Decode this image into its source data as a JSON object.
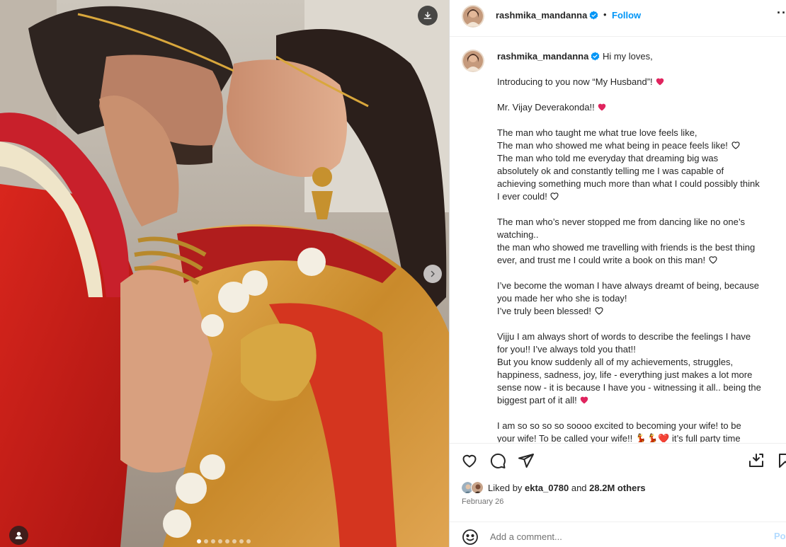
{
  "media": {
    "download_icon": "download-icon",
    "next_icon": "chevron-right-icon",
    "tag_icon": "person-tag-icon",
    "carousel_count": 8,
    "carousel_active": 0
  },
  "header": {
    "username": "rashmika_mandanna",
    "separator": "•",
    "follow": "Follow",
    "more": "···"
  },
  "caption": {
    "username": "rashmika_mandanna",
    "first_line": "Hi my loves,",
    "lines": [
      {
        "text": "",
        "heart": ""
      },
      {
        "text": "Introducing to you now “My Husband”!",
        "heart": "red"
      },
      {
        "text": "",
        "heart": ""
      },
      {
        "text": "Mr. Vijay Deverakonda!!",
        "heart": "red"
      },
      {
        "text": "",
        "heart": ""
      },
      {
        "text": "The man who taught me what true love feels like,",
        "heart": ""
      },
      {
        "text": "The man who showed me what being in peace feels like!",
        "heart": "outline"
      },
      {
        "text": "The man who told me everyday that dreaming big was",
        "heart": ""
      },
      {
        "text": "absolutely ok and constantly telling me I was capable of",
        "heart": ""
      },
      {
        "text": "achieving something much more than what I could possibly think",
        "heart": ""
      },
      {
        "text": "I ever could!",
        "heart": "outline"
      },
      {
        "text": "",
        "heart": ""
      },
      {
        "text": "The man who’s never stopped me from dancing like no one’s",
        "heart": ""
      },
      {
        "text": "watching..",
        "heart": ""
      },
      {
        "text": "the man who showed me travelling with friends is the best thing",
        "heart": ""
      },
      {
        "text": "ever, and trust me I could write a book on this man!",
        "heart": "outline"
      },
      {
        "text": "",
        "heart": ""
      },
      {
        "text": "I’ve become the woman I have always dreamt of being, because",
        "heart": ""
      },
      {
        "text": "you made her who she is today!",
        "heart": ""
      },
      {
        "text": "I’ve truly been blessed!",
        "heart": "outline"
      },
      {
        "text": "",
        "heart": ""
      },
      {
        "text": "Vijju I am always short of words to describe the feelings I have",
        "heart": ""
      },
      {
        "text": "for you!! I’ve always told you that!!",
        "heart": ""
      },
      {
        "text": "But you know suddenly all of my achievements, struggles,",
        "heart": ""
      },
      {
        "text": "happiness, sadness, joy, life - everything just makes a lot more",
        "heart": ""
      },
      {
        "text": "sense now - it is because I have you - witnessing it all.. being the",
        "heart": ""
      },
      {
        "text": "biggest part of it all!",
        "heart": "red"
      },
      {
        "text": "",
        "heart": ""
      },
      {
        "text": "I am so so so so soooo excited to becoming your wife! to be",
        "heart": ""
      },
      {
        "text": "your wife! To be called your wife!! 💃💃❤️ it’s full party time",
        "heart": ""
      }
    ]
  },
  "actions": {
    "like_icon": "heart-icon",
    "comment_icon": "comment-icon",
    "share_icon": "share-icon",
    "save_icon": "bookmark-icon",
    "add_icon": "add-to-collection-icon"
  },
  "likes": {
    "prefix": "Liked by",
    "user": "ekta_0780",
    "middle": "and",
    "others": "28.2M others"
  },
  "date": "February 26",
  "comment": {
    "placeholder": "Add a comment...",
    "post": "Post"
  },
  "colors": {
    "accent": "#0095f6",
    "verified": "#0095f6",
    "heart_red": "#e0245e",
    "post_disabled": "#b3dbff"
  }
}
